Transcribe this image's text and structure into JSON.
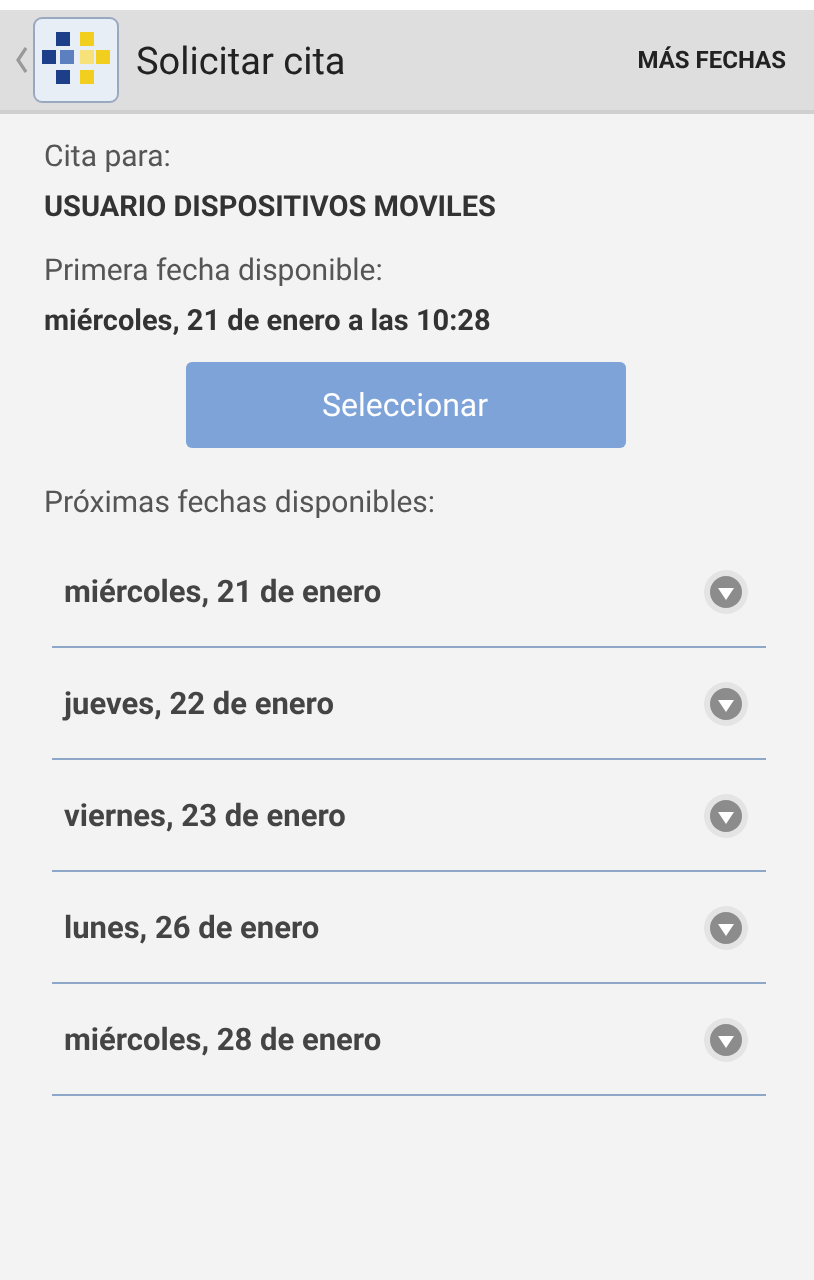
{
  "action_bar": {
    "title": "Solicitar cita",
    "action": "MÁS FECHAS"
  },
  "appointment": {
    "for_label": "Cita para:",
    "user": "USUARIO DISPOSITIVOS MOVILES",
    "first_label": "Primera fecha disponible:",
    "first_date": "miércoles, 21 de enero a las 10:28",
    "button": "Seleccionar"
  },
  "next_label": "Próximas fechas disponibles:",
  "dates": [
    {
      "label": "miércoles, 21 de enero",
      "expanded": false
    },
    {
      "label": "jueves, 22 de enero",
      "expanded": false
    },
    {
      "label": "viernes, 23 de enero",
      "expanded": false
    },
    {
      "label": "lunes, 26 de enero",
      "expanded": false
    },
    {
      "label": "miércoles, 28 de enero",
      "expanded": false
    }
  ]
}
